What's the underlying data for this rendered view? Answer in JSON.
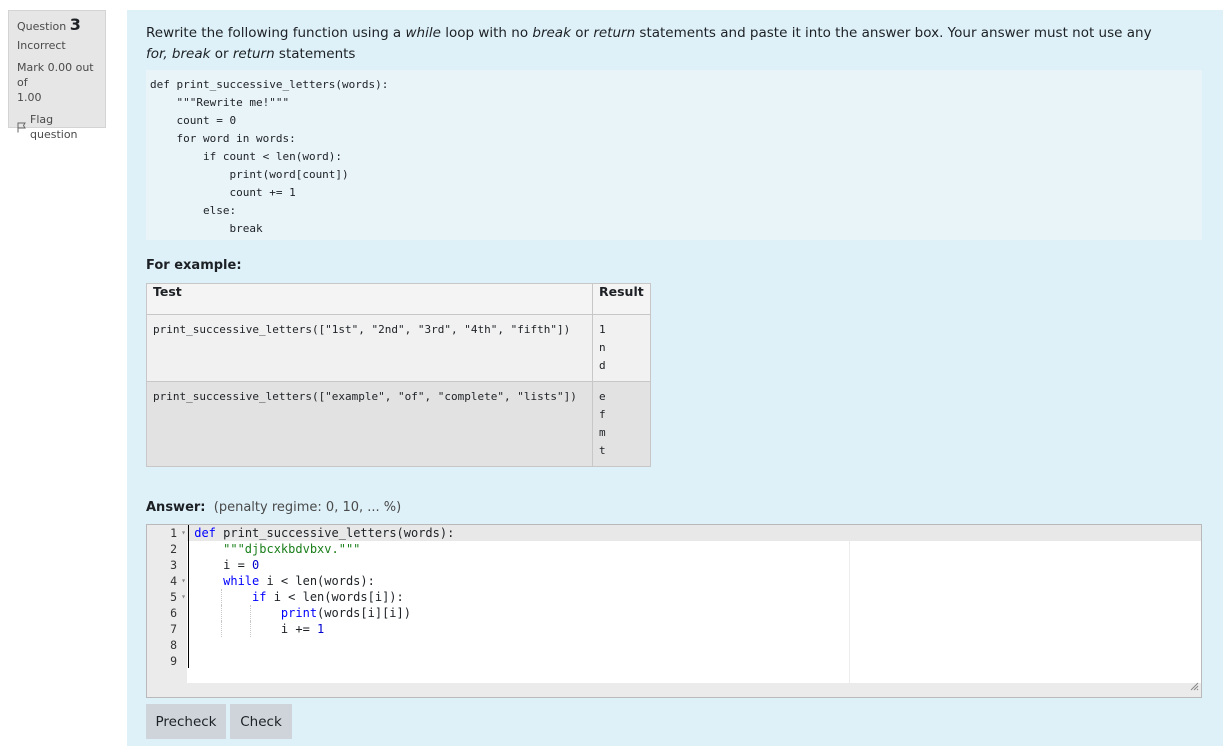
{
  "question_info": {
    "label": "Question",
    "number": "3",
    "state": "Incorrect",
    "grade_line1": "Mark 0.00 out of",
    "grade_line2": "1.00",
    "flag_label": "Flag question"
  },
  "question_text": {
    "part1": "Rewrite the following function using a ",
    "em1": "while",
    "part2": " loop with no ",
    "em2": "break",
    "part3": " or ",
    "em3": "return",
    "part4": " statements and paste it into the answer box. Your answer must not use any  ",
    "em4": "for, break",
    "part5": " or ",
    "em5": "return",
    "part6": " statements"
  },
  "code_sample": "def print_successive_letters(words):\n    \"\"\"Rewrite me!\"\"\"\n    count = 0\n    for word in words:\n        if count < len(word):\n            print(word[count])\n            count += 1\n        else:\n            break",
  "examples": {
    "heading": "For example:",
    "columns": [
      "Test",
      "Result"
    ],
    "rows": [
      {
        "test": "print_successive_letters([\"1st\", \"2nd\", \"3rd\", \"4th\", \"fifth\"])",
        "result": "1\nn\nd"
      },
      {
        "test": "print_successive_letters([\"example\", \"of\", \"complete\", \"lists\"])",
        "result": "e\nf\nm\nt"
      }
    ]
  },
  "answer": {
    "label": "Answer:",
    "penalty": "(penalty regime: 0, 10, ... %)",
    "line_numbers": [
      "1",
      "2",
      "3",
      "4",
      "5",
      "6",
      "7",
      "8",
      "9"
    ]
  },
  "buttons": {
    "precheck": "Precheck",
    "check": "Check"
  }
}
